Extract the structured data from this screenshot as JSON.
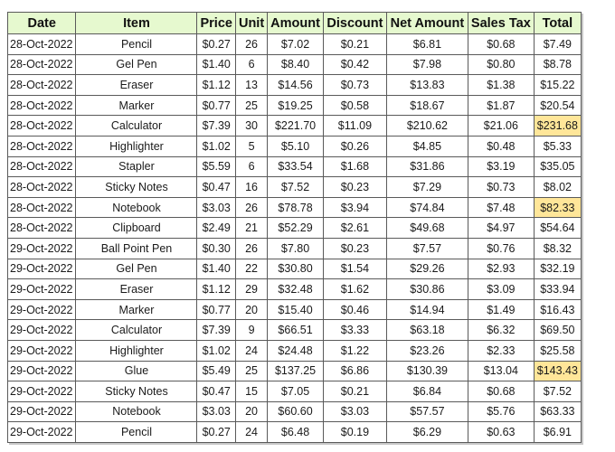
{
  "table": {
    "columns": [
      "Date",
      "Item",
      "Price",
      "Unit",
      "Amount",
      "Discount",
      "Net Amount",
      "Sales Tax",
      "Total"
    ],
    "highlight_color": "#ffe699",
    "header_color": "#e6f9cf",
    "rows": [
      {
        "date": "28-Oct-2022",
        "item": "Pencil",
        "price": "$0.27",
        "unit": "26",
        "amount": "$7.02",
        "discount": "$0.21",
        "net_amount": "$6.81",
        "sales_tax": "$0.68",
        "total": "$7.49",
        "highlight": false
      },
      {
        "date": "28-Oct-2022",
        "item": "Gel Pen",
        "price": "$1.40",
        "unit": "6",
        "amount": "$8.40",
        "discount": "$0.42",
        "net_amount": "$7.98",
        "sales_tax": "$0.80",
        "total": "$8.78",
        "highlight": false
      },
      {
        "date": "28-Oct-2022",
        "item": "Eraser",
        "price": "$1.12",
        "unit": "13",
        "amount": "$14.56",
        "discount": "$0.73",
        "net_amount": "$13.83",
        "sales_tax": "$1.38",
        "total": "$15.22",
        "highlight": false
      },
      {
        "date": "28-Oct-2022",
        "item": "Marker",
        "price": "$0.77",
        "unit": "25",
        "amount": "$19.25",
        "discount": "$0.58",
        "net_amount": "$18.67",
        "sales_tax": "$1.87",
        "total": "$20.54",
        "highlight": false
      },
      {
        "date": "28-Oct-2022",
        "item": "Calculator",
        "price": "$7.39",
        "unit": "30",
        "amount": "$221.70",
        "discount": "$11.09",
        "net_amount": "$210.62",
        "sales_tax": "$21.06",
        "total": "$231.68",
        "highlight": true
      },
      {
        "date": "28-Oct-2022",
        "item": "Highlighter",
        "price": "$1.02",
        "unit": "5",
        "amount": "$5.10",
        "discount": "$0.26",
        "net_amount": "$4.85",
        "sales_tax": "$0.48",
        "total": "$5.33",
        "highlight": false
      },
      {
        "date": "28-Oct-2022",
        "item": "Stapler",
        "price": "$5.59",
        "unit": "6",
        "amount": "$33.54",
        "discount": "$1.68",
        "net_amount": "$31.86",
        "sales_tax": "$3.19",
        "total": "$35.05",
        "highlight": false
      },
      {
        "date": "28-Oct-2022",
        "item": "Sticky Notes",
        "price": "$0.47",
        "unit": "16",
        "amount": "$7.52",
        "discount": "$0.23",
        "net_amount": "$7.29",
        "sales_tax": "$0.73",
        "total": "$8.02",
        "highlight": false
      },
      {
        "date": "28-Oct-2022",
        "item": "Notebook",
        "price": "$3.03",
        "unit": "26",
        "amount": "$78.78",
        "discount": "$3.94",
        "net_amount": "$74.84",
        "sales_tax": "$7.48",
        "total": "$82.33",
        "highlight": true
      },
      {
        "date": "28-Oct-2022",
        "item": "Clipboard",
        "price": "$2.49",
        "unit": "21",
        "amount": "$52.29",
        "discount": "$2.61",
        "net_amount": "$49.68",
        "sales_tax": "$4.97",
        "total": "$54.64",
        "highlight": false
      },
      {
        "date": "29-Oct-2022",
        "item": "Ball Point Pen",
        "price": "$0.30",
        "unit": "26",
        "amount": "$7.80",
        "discount": "$0.23",
        "net_amount": "$7.57",
        "sales_tax": "$0.76",
        "total": "$8.32",
        "highlight": false
      },
      {
        "date": "29-Oct-2022",
        "item": "Gel Pen",
        "price": "$1.40",
        "unit": "22",
        "amount": "$30.80",
        "discount": "$1.54",
        "net_amount": "$29.26",
        "sales_tax": "$2.93",
        "total": "$32.19",
        "highlight": false
      },
      {
        "date": "29-Oct-2022",
        "item": "Eraser",
        "price": "$1.12",
        "unit": "29",
        "amount": "$32.48",
        "discount": "$1.62",
        "net_amount": "$30.86",
        "sales_tax": "$3.09",
        "total": "$33.94",
        "highlight": false
      },
      {
        "date": "29-Oct-2022",
        "item": "Marker",
        "price": "$0.77",
        "unit": "20",
        "amount": "$15.40",
        "discount": "$0.46",
        "net_amount": "$14.94",
        "sales_tax": "$1.49",
        "total": "$16.43",
        "highlight": false
      },
      {
        "date": "29-Oct-2022",
        "item": "Calculator",
        "price": "$7.39",
        "unit": "9",
        "amount": "$66.51",
        "discount": "$3.33",
        "net_amount": "$63.18",
        "sales_tax": "$6.32",
        "total": "$69.50",
        "highlight": false
      },
      {
        "date": "29-Oct-2022",
        "item": "Highlighter",
        "price": "$1.02",
        "unit": "24",
        "amount": "$24.48",
        "discount": "$1.22",
        "net_amount": "$23.26",
        "sales_tax": "$2.33",
        "total": "$25.58",
        "highlight": false
      },
      {
        "date": "29-Oct-2022",
        "item": "Glue",
        "price": "$5.49",
        "unit": "25",
        "amount": "$137.25",
        "discount": "$6.86",
        "net_amount": "$130.39",
        "sales_tax": "$13.04",
        "total": "$143.43",
        "highlight": true
      },
      {
        "date": "29-Oct-2022",
        "item": "Sticky Notes",
        "price": "$0.47",
        "unit": "15",
        "amount": "$7.05",
        "discount": "$0.21",
        "net_amount": "$6.84",
        "sales_tax": "$0.68",
        "total": "$7.52",
        "highlight": false
      },
      {
        "date": "29-Oct-2022",
        "item": "Notebook",
        "price": "$3.03",
        "unit": "20",
        "amount": "$60.60",
        "discount": "$3.03",
        "net_amount": "$57.57",
        "sales_tax": "$5.76",
        "total": "$63.33",
        "highlight": false
      },
      {
        "date": "29-Oct-2022",
        "item": "Pencil",
        "price": "$0.27",
        "unit": "24",
        "amount": "$6.48",
        "discount": "$0.19",
        "net_amount": "$6.29",
        "sales_tax": "$0.63",
        "total": "$6.91",
        "highlight": false
      }
    ]
  }
}
